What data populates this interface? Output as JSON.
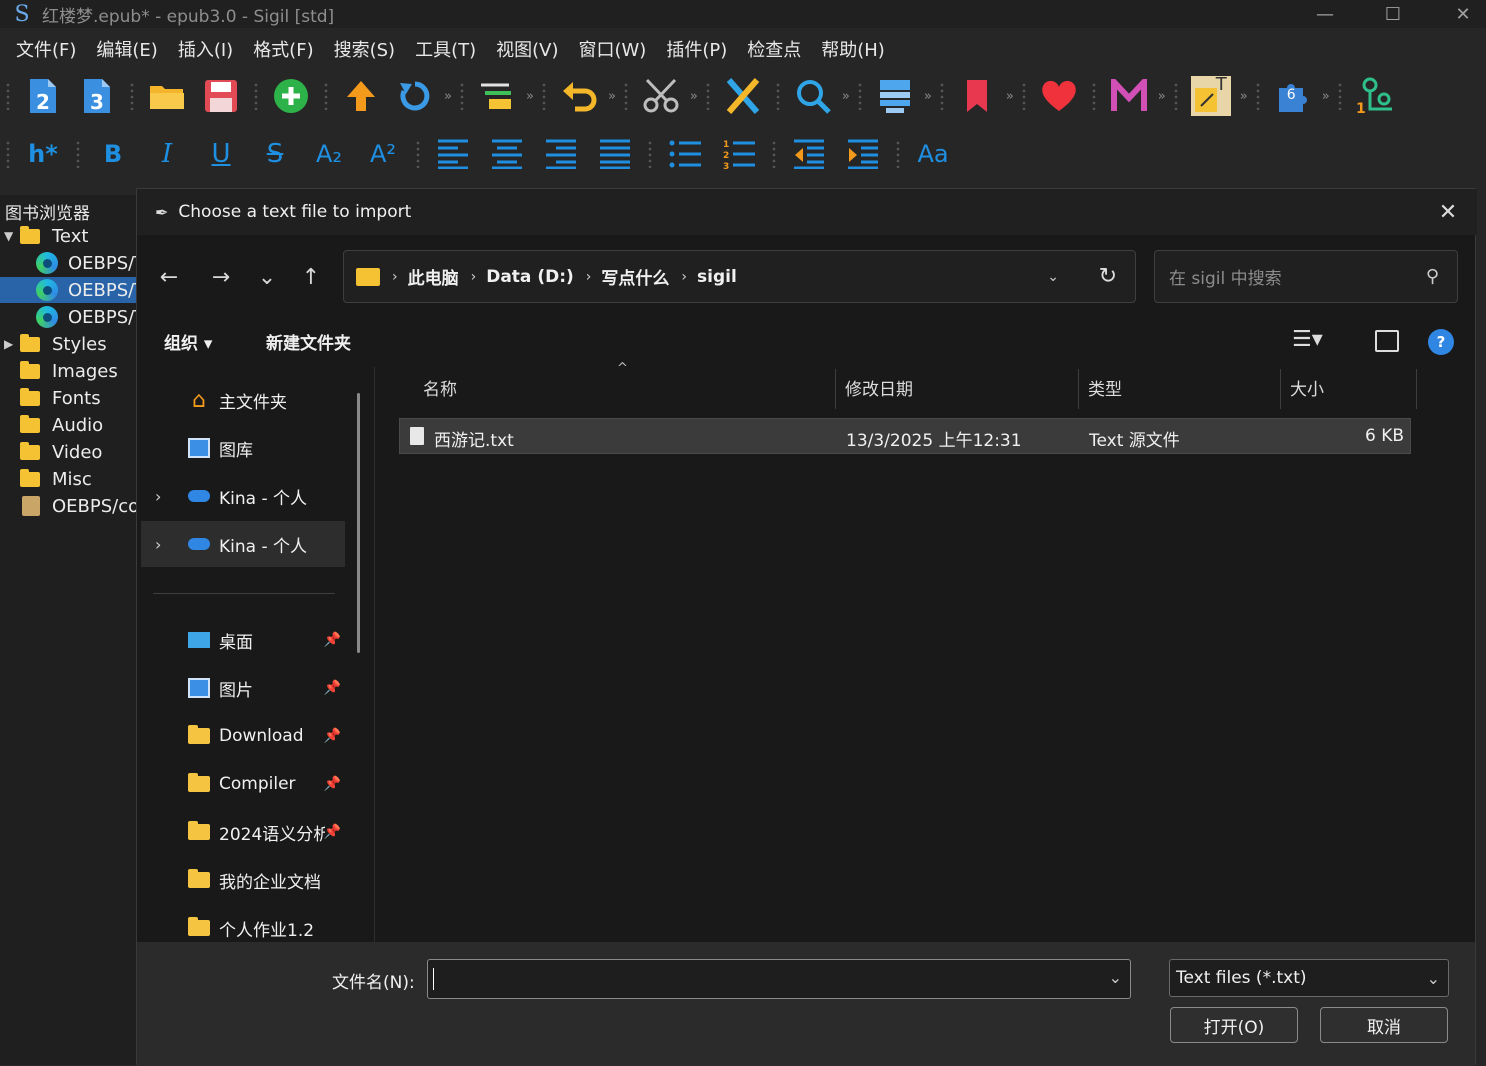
{
  "window": {
    "title": "红楼梦.epub* - epub3.0 - Sigil [std]",
    "logo_glyph": "S",
    "minimize": "—",
    "maximize": "☐",
    "close": "✕"
  },
  "menubar": [
    "文件(F)",
    "编辑(E)",
    "插入(I)",
    "格式(F)",
    "搜索(S)",
    "工具(T)",
    "视图(V)",
    "窗口(W)",
    "插件(P)",
    "检查点",
    "帮助(H)"
  ],
  "toolbar1": {
    "icons": [
      "new-file-epub2-icon",
      "new-file-epub3-icon",
      "open-folder-icon",
      "save-icon",
      "add-file-icon",
      "upload-icon",
      "refresh-icon",
      "split-icon",
      "undo-icon",
      "cut-icon",
      "crossed-tools-icon",
      "search-icon",
      "checklist-icon",
      "bookmark-icon",
      "heart-icon",
      "m-logo-icon",
      "text-insert-icon",
      "plugin-icon",
      "tree-icon"
    ],
    "labels": {
      "epub2": "2",
      "epub3": "3",
      "plugin_badge": "6",
      "text_insert": "T"
    }
  },
  "toolbar2": {
    "heading": "h*",
    "bold": "B",
    "italic": "I",
    "underline": "U",
    "strike": "S",
    "subscript": "A₂",
    "superscript": "A²",
    "case": "Aa"
  },
  "book_browser": {
    "title": "图书浏览器",
    "items": [
      {
        "label": "Text",
        "type": "folder",
        "expanded": true
      },
      {
        "label": "OEBPS/Text/",
        "type": "file"
      },
      {
        "label": "OEBPS/Text/",
        "type": "file",
        "selected": true
      },
      {
        "label": "OEBPS/Text/",
        "type": "file"
      },
      {
        "label": "Styles",
        "type": "folder"
      },
      {
        "label": "Images",
        "type": "folder"
      },
      {
        "label": "Fonts",
        "type": "folder"
      },
      {
        "label": "Audio",
        "type": "folder"
      },
      {
        "label": "Video",
        "type": "folder"
      },
      {
        "label": "Misc",
        "type": "folder"
      },
      {
        "label": "OEBPS/content.opf",
        "type": "opf"
      }
    ]
  },
  "dialog": {
    "title": "Choose a text file to import",
    "nav": {
      "back": "←",
      "forward": "→",
      "recent": "⌄",
      "up": "↑"
    },
    "breadcrumb": [
      "此电脑",
      "Data (D:)",
      "写点什么",
      "sigil"
    ],
    "search_placeholder": "在 sigil 中搜索",
    "organize": "组织 ▾",
    "new_folder": "新建文件夹",
    "nav_pane": [
      {
        "label": "主文件夹",
        "icon": "home-icon"
      },
      {
        "label": "图库",
        "icon": "gallery-icon"
      },
      {
        "label": "Kina - 个人",
        "icon": "onedrive-icon",
        "expandable": true
      },
      {
        "label": "Kina - 个人",
        "icon": "onedrive-icon",
        "expandable": true,
        "active": true
      },
      {
        "label": "桌面",
        "icon": "desktop-icon",
        "pinned": true
      },
      {
        "label": "图片",
        "icon": "pictures-icon",
        "pinned": true
      },
      {
        "label": "Download",
        "icon": "folder-icon",
        "pinned": true
      },
      {
        "label": "Compiler",
        "icon": "folder-icon",
        "pinned": true
      },
      {
        "label": "2024语义分析",
        "icon": "folder-icon",
        "pinned": true
      },
      {
        "label": "我的企业文档",
        "icon": "folder-icon"
      },
      {
        "label": "个人作业1.2",
        "icon": "folder-icon"
      }
    ],
    "columns": [
      "名称",
      "修改日期",
      "类型",
      "大小"
    ],
    "files": [
      {
        "name": "西游记.txt",
        "modified": "13/3/2025 上午12:31",
        "type": "Text 源文件",
        "size": "6 KB"
      }
    ],
    "filename_label": "文件名(N):",
    "filename_value": "",
    "filetype": "Text files (*.txt)",
    "open_button": "打开(O)",
    "cancel_button": "取消"
  },
  "colors": {
    "accent_blue": "#2963a8",
    "folder_yellow": "#f4c233",
    "toolbar_blue": "#1e8fe1"
  }
}
